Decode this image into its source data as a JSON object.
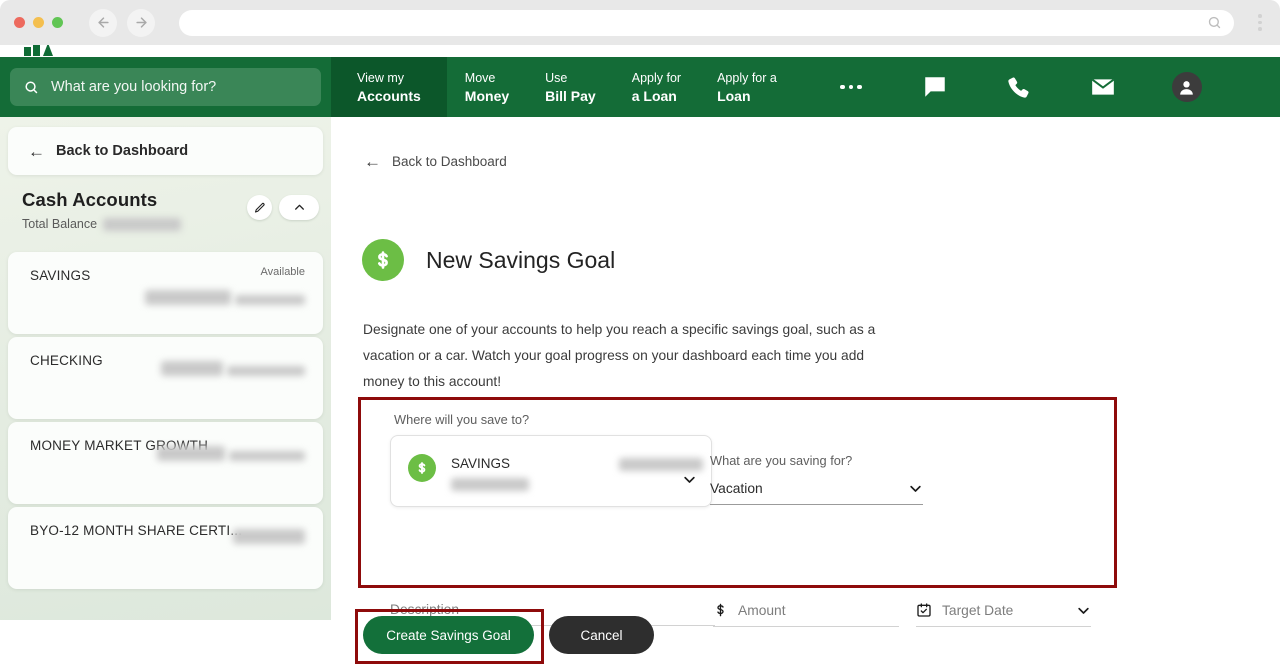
{
  "browser": {
    "back_icon": "arrow-left-icon",
    "forward_icon": "arrow-right-icon",
    "url_value": "",
    "url_search_icon": "search-icon",
    "menu_icon": "kebab-menu-icon"
  },
  "topnav": {
    "search": {
      "icon": "search-icon",
      "placeholder": "What are you looking for?",
      "value": ""
    },
    "items": [
      {
        "line1": "View my",
        "line2": "Accounts",
        "active": true
      },
      {
        "line1": "Move",
        "line2": "Money",
        "active": false
      },
      {
        "line1": "Use",
        "line2": "Bill Pay",
        "active": false
      },
      {
        "line1": "Apply for",
        "line2": "a Loan",
        "active": false
      },
      {
        "line1": "Apply for a",
        "line2": "Loan",
        "active": false
      }
    ],
    "more_icon": "ellipsis-icon",
    "icons": [
      "chat-icon",
      "phone-icon",
      "mail-icon",
      "avatar-icon"
    ]
  },
  "sidebar": {
    "back_label": "Back to Dashboard",
    "back_icon": "arrow-left-icon",
    "section_title": "Cash Accounts",
    "total_balance_label": "Total Balance",
    "total_balance_value": "",
    "edit_icon": "pencil-icon",
    "collapse_icon": "chevron-up-icon",
    "accounts": [
      {
        "name": "SAVINGS",
        "available_label": "Available",
        "balance": ""
      },
      {
        "name": "CHECKING",
        "available_label": "",
        "balance": ""
      },
      {
        "name": "MONEY MARKET GROWTH",
        "available_label": "",
        "balance": ""
      },
      {
        "name": "BYO-12 MONTH SHARE CERTI...",
        "available_label": "",
        "balance": ""
      }
    ]
  },
  "main": {
    "back_label": "Back to Dashboard",
    "back_icon": "arrow-left-icon",
    "title": "New Savings Goal",
    "title_icon": "dollar-circle-icon",
    "description": "Designate one of your accounts to help you reach a specific savings goal, such as a vacation or a car. Watch your goal progress on your dashboard each time you add money to this account!",
    "form": {
      "where_label": "Where will you save to?",
      "account": {
        "icon": "dollar-circle-icon",
        "name": "SAVINGS",
        "balance": "",
        "sub": "",
        "chevron_icon": "chevron-down-icon"
      },
      "saving_for": {
        "label": "What are you saving for?",
        "value": "Vacation",
        "chevron_icon": "chevron-down-icon"
      },
      "description_field": {
        "placeholder": "Description",
        "value": ""
      },
      "amount_field": {
        "icon": "dollar-sign-icon",
        "placeholder": "Amount",
        "value": ""
      },
      "target_date_field": {
        "icon": "calendar-icon",
        "placeholder": "Target Date",
        "value": "",
        "chevron_icon": "chevron-down-icon"
      }
    },
    "buttons": {
      "create_label": "Create Savings Goal",
      "cancel_label": "Cancel"
    }
  },
  "colors": {
    "nav_green": "#146c37",
    "nav_active_green": "#0c572a",
    "accent_green": "#6cbe45",
    "button_green": "#13703a",
    "annotation_red": "#8e0b0b",
    "cancel_dark": "#2e2e2e"
  }
}
